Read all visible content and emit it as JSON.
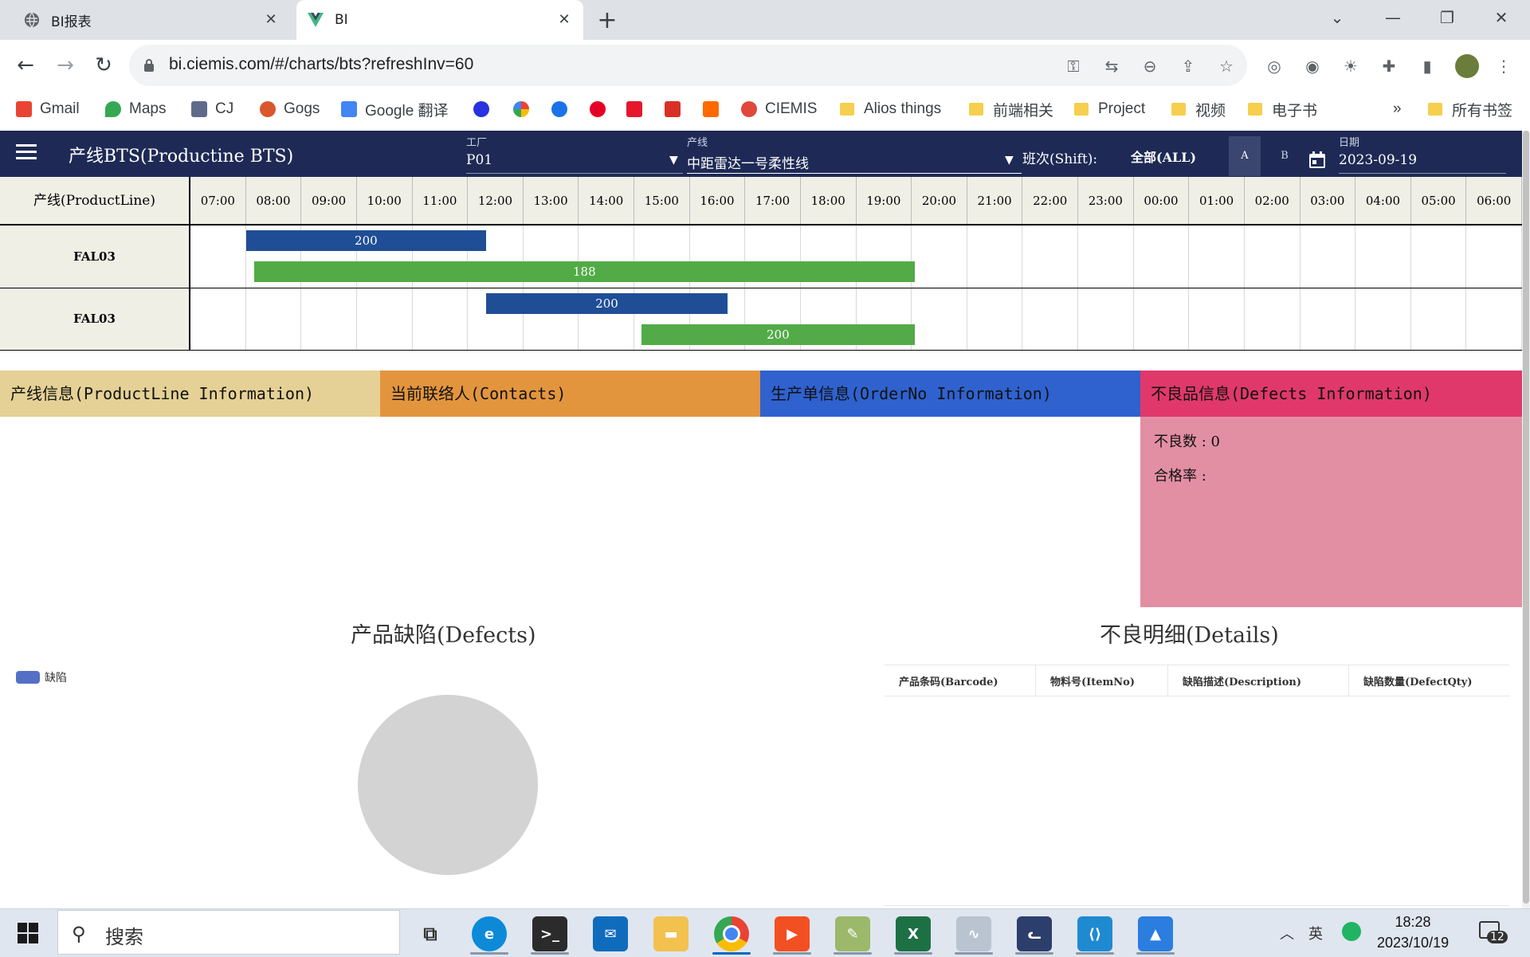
{
  "browser": {
    "tabs": [
      {
        "title": "BI报表",
        "icon": "globe-icon"
      },
      {
        "title": "BI",
        "icon": "vue-icon"
      }
    ],
    "url": "bi.ciemis.com/#/charts/bts?refreshInv=60",
    "bookmarks": [
      {
        "label": "Gmail",
        "color": "#ea4335"
      },
      {
        "label": "Maps",
        "color": "#34a853"
      },
      {
        "label": "CJ",
        "color": "#5f6b8a"
      },
      {
        "label": "Gogs",
        "color": "#d9572c"
      },
      {
        "label": "Google 翻译",
        "color": "#4285f4"
      },
      {
        "label": "CIEMIS",
        "color": "#e0483b"
      },
      {
        "label": "Alios things",
        "color": "#f6cf4e"
      },
      {
        "label": "前端相关",
        "color": "#f6cf4e"
      },
      {
        "label": "Project",
        "color": "#f6cf4e"
      },
      {
        "label": "视频",
        "color": "#f6cf4e"
      },
      {
        "label": "电子书",
        "color": "#f6cf4e"
      },
      {
        "label": "所有书签",
        "color": "#f6cf4e"
      }
    ],
    "overflow": "»"
  },
  "app": {
    "title": "产线BTS(Productine BTS)",
    "factory_label": "工厂",
    "factory_value": "P01",
    "line_label": "产线",
    "line_value": "中距雷达一号柔性线",
    "shift_label": "班次(Shift):",
    "shift_all": "全部(ALL)",
    "shift_a": "A",
    "shift_b": "B",
    "date_label": "日期",
    "date_value": "2023-09-19",
    "header_color": "#1e2a55"
  },
  "gantt": {
    "row_header": "产线(ProductLine)",
    "hours": [
      "07:00",
      "08:00",
      "09:00",
      "10:00",
      "11:00",
      "12:00",
      "13:00",
      "14:00",
      "15:00",
      "16:00",
      "17:00",
      "18:00",
      "19:00",
      "20:00",
      "21:00",
      "22:00",
      "23:00",
      "00:00",
      "01:00",
      "02:00",
      "03:00",
      "04:00",
      "05:00",
      "06:00"
    ],
    "rows": [
      {
        "line": "FAL03",
        "bars": [
          {
            "label": "200",
            "start": 8.0,
            "end": 12.33,
            "color": "#1f4e96"
          },
          {
            "label": "188",
            "start": 8.15,
            "end": 20.05,
            "color": "#52ab47"
          }
        ]
      },
      {
        "line": "FAL03",
        "bars": [
          {
            "label": "200",
            "start": 12.33,
            "end": 16.68,
            "color": "#1f4e96"
          },
          {
            "label": "200",
            "start": 15.13,
            "end": 20.05,
            "color": "#52ab47"
          }
        ]
      }
    ]
  },
  "sections": {
    "productline": {
      "title": "产线信息(ProductLine Information)",
      "color": "#e5d195"
    },
    "contacts": {
      "title": "当前联络人(Contacts)",
      "color": "#e3953e"
    },
    "orderno": {
      "title": "生产单信息(OrderNo Information)",
      "color": "#2f62cf"
    },
    "defects": {
      "title": "不良品信息(Defects Information)",
      "color": "#e0386a",
      "defect_count": "不良数 : 0",
      "pass_rate": "合格率 :",
      "body_color": "#e28fa4"
    }
  },
  "defects_chart": {
    "title": "产品缺陷(Defects)",
    "legend": "缺陷",
    "legend_color": "#5470c6",
    "empty_color": "#d3d3d3"
  },
  "chart_data": {
    "type": "pie",
    "title": "产品缺陷(Defects)",
    "series": [
      {
        "name": "缺陷",
        "values": []
      }
    ],
    "legend": "top-left"
  },
  "details": {
    "title": "不良明细(Details)",
    "columns": [
      "产品条码(Barcode)",
      "物料号(ItemNo)",
      "缺陷描述(Description)",
      "缺陷数量(DefectQty)"
    ],
    "rows": []
  },
  "taskbar": {
    "search": "搜索",
    "ime": "英",
    "time": "18:28",
    "date": "2023/10/19",
    "notifications": "12"
  }
}
